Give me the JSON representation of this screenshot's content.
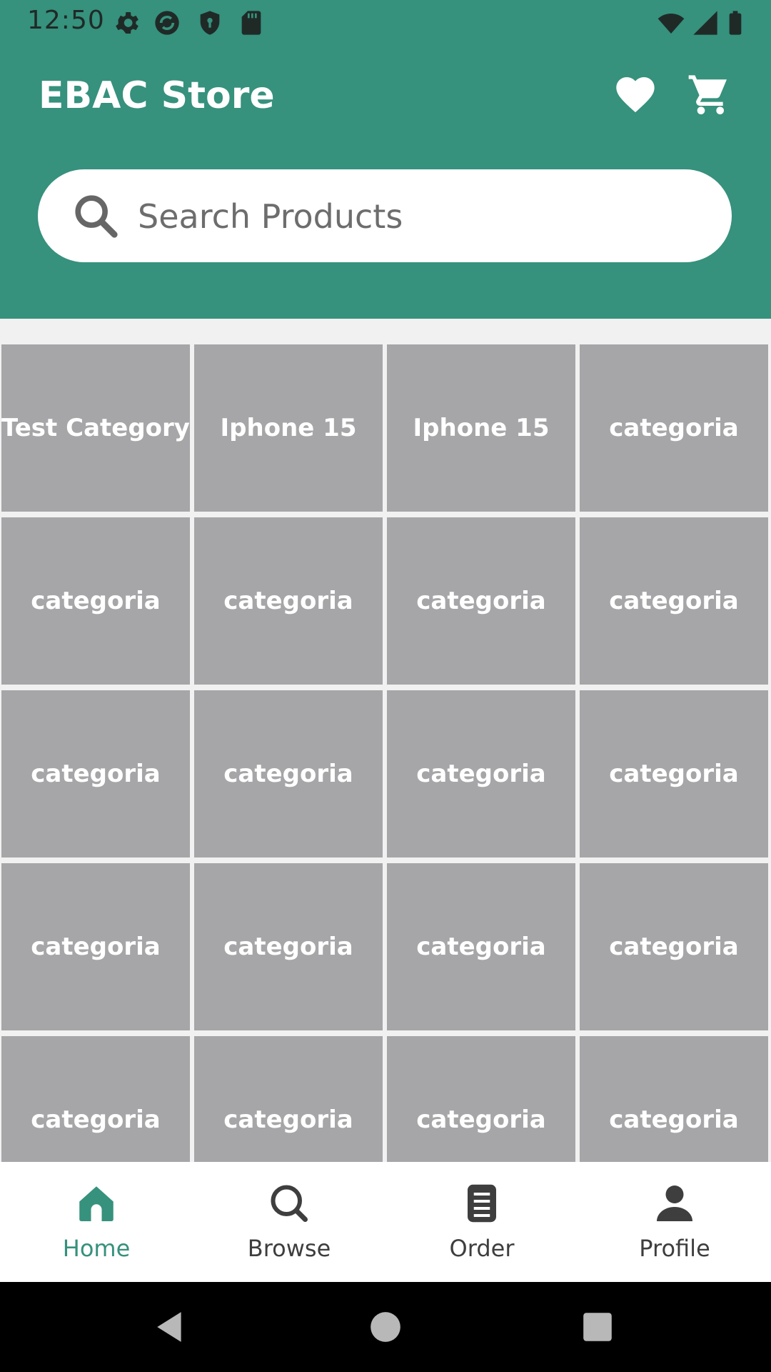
{
  "status_bar": {
    "time": "12:50"
  },
  "header": {
    "title": "EBAC Store",
    "favorites_icon": "heart-icon",
    "cart_icon": "cart-icon"
  },
  "search": {
    "placeholder": "Search Products",
    "value": ""
  },
  "categories": [
    "Test Category",
    "Iphone 15",
    "Iphone 15",
    "categoria",
    "categoria",
    "categoria",
    "categoria",
    "categoria",
    "categoria",
    "categoria",
    "categoria",
    "categoria",
    "categoria",
    "categoria",
    "categoria",
    "categoria",
    "categoria",
    "categoria",
    "categoria",
    "categoria"
  ],
  "bottom_nav": {
    "items": [
      {
        "label": "Home",
        "icon": "home-icon",
        "active": true
      },
      {
        "label": "Browse",
        "icon": "search-icon",
        "active": false
      },
      {
        "label": "Order",
        "icon": "order-icon",
        "active": false
      },
      {
        "label": "Profile",
        "icon": "profile-icon",
        "active": false
      }
    ]
  },
  "colors": {
    "primary": "#36917D",
    "tile": "#a6a6a8",
    "background": "#f1f1f1"
  }
}
